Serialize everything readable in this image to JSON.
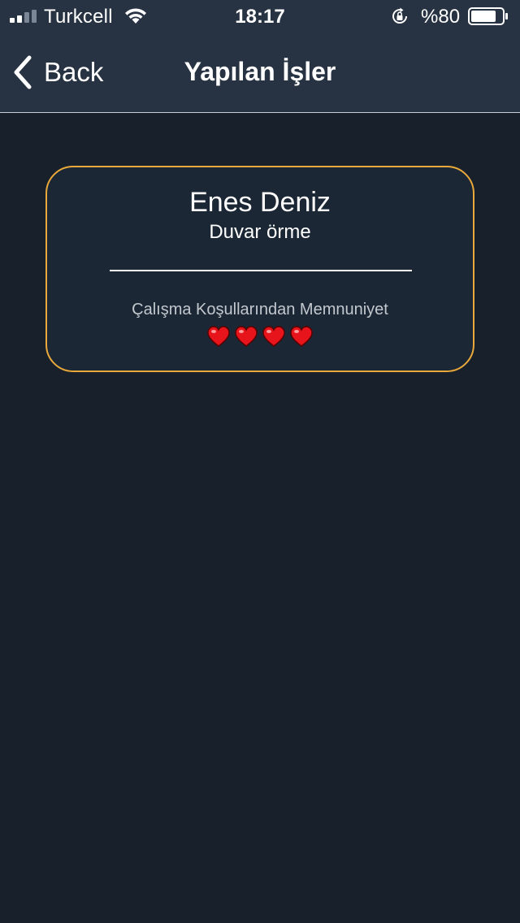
{
  "status_bar": {
    "carrier": "Turkcell",
    "time": "18:17",
    "battery_percent": "%80",
    "battery_level": 0.8,
    "signal_bars_active": 2,
    "signal_bars_total": 4
  },
  "nav": {
    "back_label": "Back",
    "title": "Yapılan İşler"
  },
  "card": {
    "worker_name": "Enes Deniz",
    "job": "Duvar örme",
    "satisfaction_label": "Çalışma Koşullarından Memnuniyet",
    "rating": 4,
    "heart_icon": "heart-icon",
    "border_color": "#e9a83a",
    "heart_color": "#e8141c"
  },
  "colors": {
    "background": "#18202b",
    "header": "#273342",
    "card_background": "#1b2735"
  }
}
